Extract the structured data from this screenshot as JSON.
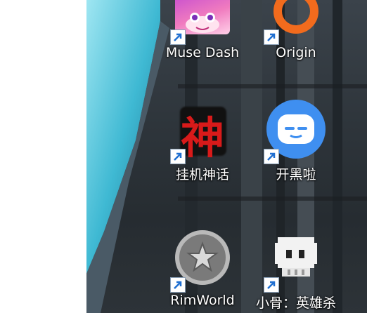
{
  "desktop": {
    "icons": [
      {
        "label": "Muse Dash",
        "icon": "muse-dash-icon"
      },
      {
        "label": "Origin",
        "icon": "origin-icon"
      },
      {
        "label": "挂机神话",
        "icon": "guaji-shenhua-icon",
        "glyph": "神"
      },
      {
        "label": "开黑啦",
        "icon": "kaiheila-icon"
      },
      {
        "label": "RimWorld",
        "icon": "rimworld-icon"
      },
      {
        "label": "小骨：英雄杀",
        "icon": "skul-icon"
      }
    ]
  },
  "colors": {
    "origin": "#f26b1d",
    "kaiheila": "#3f8ff0",
    "shen_glyph": "#d81a1a",
    "label_text": "#ffffff"
  }
}
